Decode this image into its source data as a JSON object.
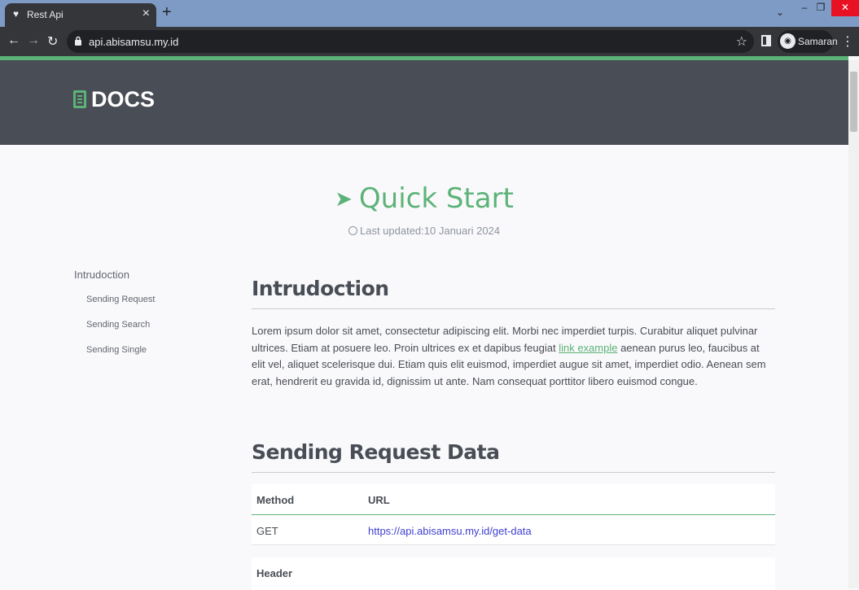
{
  "browser": {
    "tab_title": "Rest Api",
    "url": "api.abisamsu.my.id",
    "profile_name": "Samaran"
  },
  "site": {
    "logo_text": "DOCS",
    "accent_color": "#5cb377",
    "header_color": "#494d55"
  },
  "hero": {
    "title": "Quick Start",
    "last_updated": "Last updated:10 Januari 2024"
  },
  "sidenav": {
    "top_item": "Intrudoction",
    "items": [
      "Sending Request",
      "Sending Search",
      "Sending Single"
    ]
  },
  "content": {
    "intro_heading": "Intrudoction",
    "intro_text_1": "Lorem ipsum dolor sit amet, consectetur adipiscing elit. Morbi nec imperdiet turpis. Curabitur aliquet pulvinar ultrices. Etiam at posuere leo. Proin ultrices ex et dapibus feugiat ",
    "intro_link": "link example",
    "intro_text_2": " aenean purus leo, faucibus at elit vel, aliquet scelerisque dui. Etiam quis elit euismod, imperdiet augue sit amet, imperdiet odio. Aenean sem erat, hendrerit eu gravida id, dignissim ut ante. Nam consequat porttitor libero euismod congue.",
    "section_heading": "Sending Request Data",
    "table": {
      "headers": [
        "Method",
        "URL"
      ],
      "rows": [
        [
          "GET",
          "https://api.abisamsu.my.id/get-data"
        ]
      ]
    },
    "table2_header": "Header"
  }
}
